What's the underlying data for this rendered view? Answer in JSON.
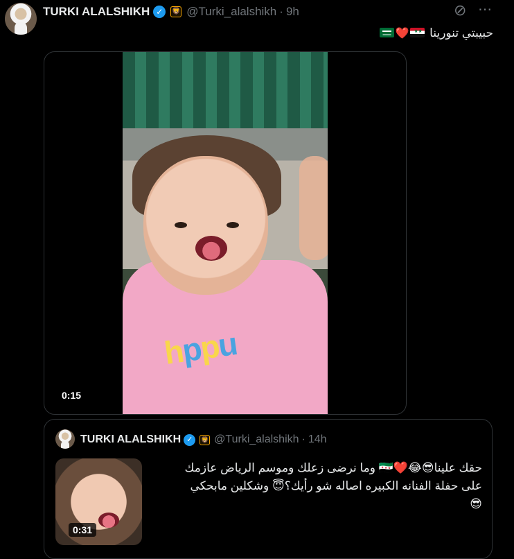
{
  "tweet": {
    "author_name": "TURKI ALALSHIKH",
    "handle": "@Turki_alalshikh",
    "separator": "·",
    "time": "9h",
    "verified_icon": "check-icon",
    "org_badge": "🦁",
    "text_main": "حبيبتي تنورينا",
    "text_emojis": [
      "flag-syria",
      "red-heart",
      "flag-saudi-arabia"
    ],
    "heart": "❤️",
    "grok_icon": "⊘",
    "more_icon": "⋯",
    "video": {
      "duration": "0:15",
      "shirt_logo": "ppu",
      "logo_letters": [
        "h",
        "p",
        "p",
        "u"
      ]
    }
  },
  "quoted_tweet": {
    "author_name": "TURKI ALALSHIKH",
    "handle": "@Turki_alalshikh",
    "separator": "·",
    "time": "14h",
    "org_badge": "🦁",
    "line1": "حقك علينا😎😂❤️🇸🇾 وما نرضى زعلك وموسم الرياض عازمك",
    "line2": "على حفلة الفنانه الكبيره اصاله شو رأيك؟😇  وشكلين مابحكي",
    "line3": "😎",
    "video_duration": "0:31"
  },
  "colors": {
    "background": "#000000",
    "text": "#e7e9ea",
    "muted": "#71767b",
    "border": "#2f3336",
    "verified": "#1d9bf0",
    "org_badge": "#f4a300",
    "heart": "#e0245e"
  }
}
